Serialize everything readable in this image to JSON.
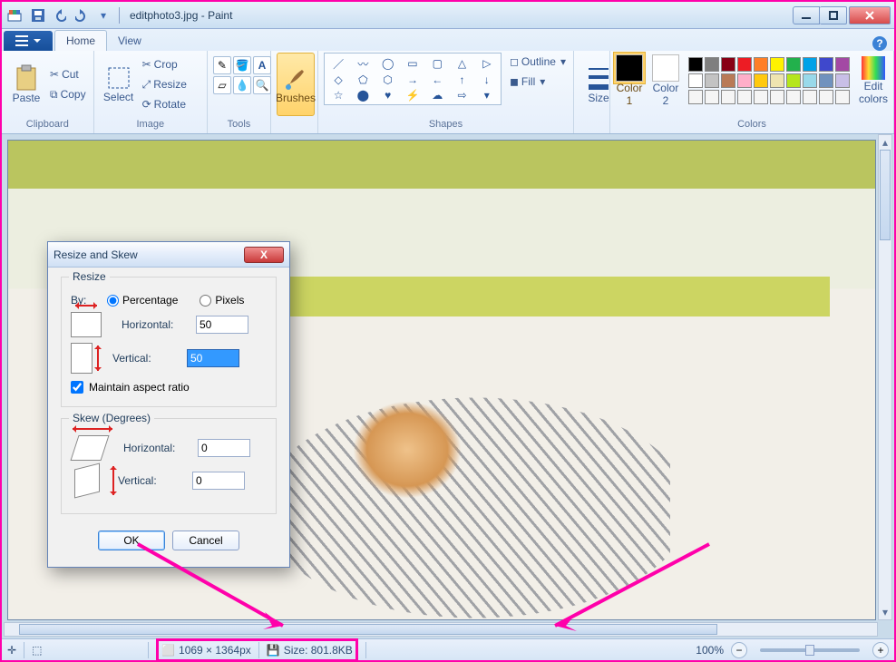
{
  "title": "editphoto3.jpg - Paint",
  "tabs": {
    "file": "",
    "home": "Home",
    "view": "View"
  },
  "ribbon": {
    "clipboard": {
      "paste": "Paste",
      "cut": "Cut",
      "copy": "Copy"
    },
    "image": {
      "crop": "Crop",
      "resize": "Resize",
      "rotate": "Rotate"
    },
    "tools_label": "",
    "brushes": "Brushes",
    "shapes": {
      "label": "Shapes",
      "outline": "Outline",
      "fill": "Fill"
    },
    "size": "Size",
    "colors": {
      "color1": "Color\n1",
      "color2": "Color\n2",
      "label": "Colors",
      "edit": "Edit\ncolors"
    }
  },
  "dialog": {
    "title": "Resize and Skew",
    "resize": {
      "legend": "Resize",
      "by_label": "By:",
      "percentage": "Percentage",
      "pixels": "Pixels",
      "horizontal": "Horizontal:",
      "vertical": "Vertical:",
      "h_value": "50",
      "v_value": "50",
      "maintain": "Maintain aspect ratio"
    },
    "skew": {
      "legend": "Skew (Degrees)",
      "horizontal": "Horizontal:",
      "vertical": "Vertical:",
      "h_value": "0",
      "v_value": "0"
    },
    "ok": "OK",
    "cancel": "Cancel"
  },
  "status": {
    "dimensions": "1069 × 1364px",
    "size": "Size: 801.8KB",
    "zoom": "100%"
  },
  "swatches": [
    "#000000",
    "#7f7f7f",
    "#880015",
    "#ed1c24",
    "#ff7f27",
    "#fff200",
    "#22b14c",
    "#00a2e8",
    "#3f48cc",
    "#a349a4",
    "#ffffff",
    "#c3c3c3",
    "#b97a57",
    "#ffaec9",
    "#ffc90e",
    "#efe4b0",
    "#b5e61d",
    "#99d9ea",
    "#7092be",
    "#c8bfe7",
    "#f5f5f5",
    "#f5f5f5",
    "#f5f5f5",
    "#f5f5f5",
    "#f5f5f5",
    "#f5f5f5",
    "#f5f5f5",
    "#f5f5f5",
    "#f5f5f5",
    "#f5f5f5"
  ]
}
